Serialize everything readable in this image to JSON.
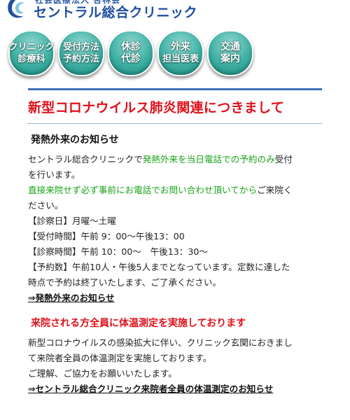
{
  "header": {
    "org_name": "社会医療法人 杏林会",
    "clinic_name": "セントラル総合クリニック"
  },
  "nav": {
    "items": [
      {
        "line1": "クリニック",
        "line2": "診療科"
      },
      {
        "line1": "受付方法",
        "line2": "予約方法"
      },
      {
        "line1": "休診",
        "line2": "代診"
      },
      {
        "line1": "外来",
        "line2": "担当医表"
      },
      {
        "line1": "交通",
        "line2": "案内"
      }
    ]
  },
  "main": {
    "title": "新型コロナウイルス肺炎関連につきまして",
    "fever": {
      "heading": "発熱外来のお知らせ",
      "p1_line1_a": "セントラル総合クリニックで",
      "p1_line1_green": "発熱外来を当日電話での予約のみ",
      "p1_line1_b": "受付",
      "p1_line2": "を行います。",
      "p2_line1_green": "直接来院せず必ず事前にお電話でお問い合わせ頂いてから",
      "p2_line1_b": "ご来院く",
      "p2_line2": "ださい。",
      "days": "【診察日】月曜～土曜",
      "reception": "【受付時間】午前 9：00～午後13：00",
      "hours": "【診察時間】午前 10：00～　午後13：30～",
      "limit_line1": "【予約数】午前10人・午後5人までとなっています。定数に達した",
      "limit_line2": "時点で予約は終了いたします、ご了承ください。",
      "link": "⇒発熱外来のお知らせ"
    },
    "temperature": {
      "heading": "来院される方全員に体温測定を実施しております",
      "line1": "新型コロナウイルスの感染拡大に伴い、クリニック玄関におきまし",
      "line2": "て来院者全員の体温測定を実施しております。",
      "line3": "ご理解、ご協力をお願いいたします。",
      "link": "⇒セントラル総合クリニック来院者全員の体温測定のお知らせ"
    }
  },
  "colors": {
    "accent_blue": "#1f4fa3",
    "title_red": "#e0101a",
    "highlight_green": "#18a318",
    "bubble_teal": "#3fb0a4"
  },
  "icons": {
    "logo": "swirl-logo-icon"
  }
}
